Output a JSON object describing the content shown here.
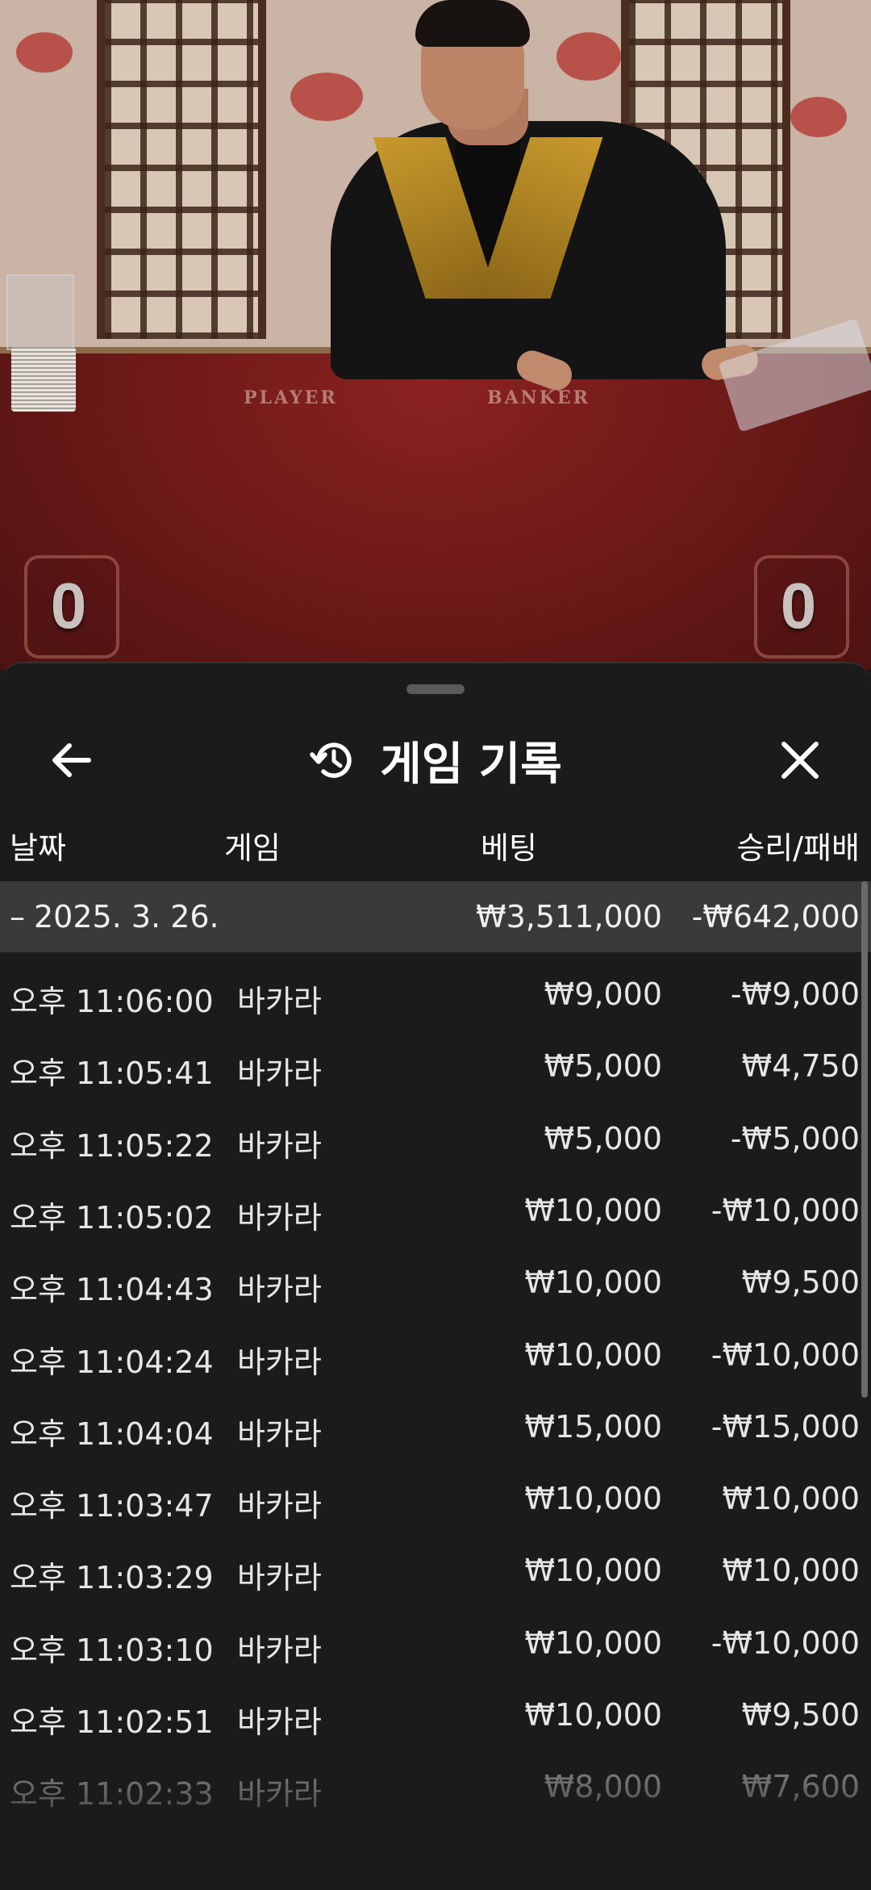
{
  "video": {
    "table_labels": {
      "player": "PLAYER",
      "banker": "BANKER"
    },
    "scores": {
      "player": "0",
      "banker": "0"
    }
  },
  "sheet": {
    "title": "게임 기록",
    "icons": {
      "back": "back-arrow-icon",
      "history": "history-icon",
      "close": "close-icon"
    }
  },
  "columns": {
    "date": "날짜",
    "game": "게임",
    "bet": "베팅",
    "result": "승리/패배"
  },
  "group": {
    "toggle": "–",
    "date": "2025. 3. 26.",
    "bet_total": "₩3,511,000",
    "result_total": "-₩642,000"
  },
  "rows": [
    {
      "time": "오후 11:06:00",
      "game": "바카라",
      "bet": "₩9,000",
      "result": "-₩9,000"
    },
    {
      "time": "오후 11:05:41",
      "game": "바카라",
      "bet": "₩5,000",
      "result": "₩4,750"
    },
    {
      "time": "오후 11:05:22",
      "game": "바카라",
      "bet": "₩5,000",
      "result": "-₩5,000"
    },
    {
      "time": "오후 11:05:02",
      "game": "바카라",
      "bet": "₩10,000",
      "result": "-₩10,000"
    },
    {
      "time": "오후 11:04:43",
      "game": "바카라",
      "bet": "₩10,000",
      "result": "₩9,500"
    },
    {
      "time": "오후 11:04:24",
      "game": "바카라",
      "bet": "₩10,000",
      "result": "-₩10,000"
    },
    {
      "time": "오후 11:04:04",
      "game": "바카라",
      "bet": "₩15,000",
      "result": "-₩15,000"
    },
    {
      "time": "오후 11:03:47",
      "game": "바카라",
      "bet": "₩10,000",
      "result": "₩10,000"
    },
    {
      "time": "오후 11:03:29",
      "game": "바카라",
      "bet": "₩10,000",
      "result": "₩10,000"
    },
    {
      "time": "오후 11:03:10",
      "game": "바카라",
      "bet": "₩10,000",
      "result": "-₩10,000"
    },
    {
      "time": "오후 11:02:51",
      "game": "바카라",
      "bet": "₩10,000",
      "result": "₩9,500"
    },
    {
      "time": "오후 11:02:33",
      "game": "바카라",
      "bet": "₩8,000",
      "result": "₩7,600"
    }
  ]
}
